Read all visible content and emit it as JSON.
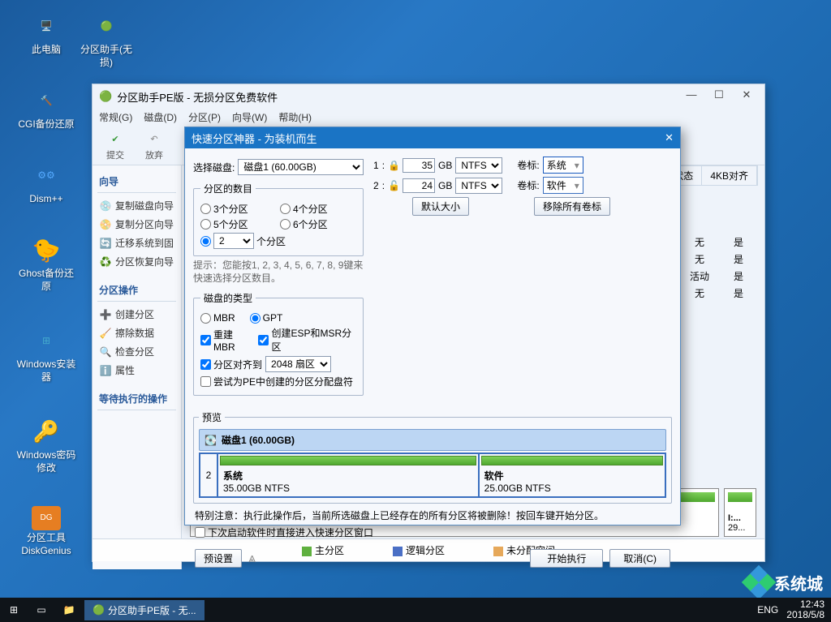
{
  "desktop": {
    "icons": [
      {
        "label": "此电脑",
        "icon": "🖥️"
      },
      {
        "label": "分区助手(无损)",
        "icon": "🔴"
      },
      {
        "label": "CGI备份还原",
        "icon": "🔨"
      },
      {
        "label": "Dism++",
        "icon": "⚙️"
      },
      {
        "label": "Ghost备份还原",
        "icon": "👻"
      },
      {
        "label": "Windows安装器",
        "icon": "🪟"
      },
      {
        "label": "Windows密码修改",
        "icon": "🔑"
      },
      {
        "label": "分区工具DiskGenius",
        "icon": "📀"
      }
    ]
  },
  "taskbar": {
    "app": "分区助手PE版 - 无...",
    "lang": "ENG",
    "time": "12:43",
    "date": "2018/5/8"
  },
  "watermark": "系统城",
  "main": {
    "title": "分区助手PE版 - 无损分区免费软件",
    "menu": [
      "常规(G)",
      "磁盘(D)",
      "分区(P)",
      "向导(W)",
      "帮助(H)"
    ],
    "tools": [
      {
        "label": "提交",
        "icon": "✔"
      },
      {
        "label": "放弃",
        "icon": "↩"
      }
    ],
    "sidebar": {
      "sec1": {
        "title": "向导",
        "items": [
          "复制磁盘向导",
          "复制分区向导",
          "迁移系统到固",
          "分区恢复向导"
        ]
      },
      "sec2": {
        "title": "分区操作",
        "items": [
          "创建分区",
          "擦除数据",
          "检查分区",
          "属性"
        ]
      },
      "sec3": {
        "title": "等待执行的操作"
      }
    },
    "grid": {
      "cols": [
        "状态",
        "4KB对齐"
      ],
      "rows": [
        [
          "无",
          "是"
        ],
        [
          "无",
          "是"
        ],
        [
          "活动",
          "是"
        ],
        [
          "无",
          "是"
        ]
      ]
    },
    "disks": [
      {
        "label": "I:...",
        "size": "29..."
      }
    ],
    "legend": {
      "primary": "主分区",
      "logical": "逻辑分区",
      "unalloc": "未分配空间"
    }
  },
  "dlg": {
    "title": "快速分区神器 - 为装机而生",
    "select_disk": "选择磁盘:",
    "disk_opt": "磁盘1 (60.00GB)",
    "count_label": "分区的数目",
    "counts": [
      "3个分区",
      "4个分区",
      "5个分区",
      "6个分区"
    ],
    "count_suffix": "个分区",
    "count_sel": "2",
    "hint": "提示：您能按1, 2, 3, 4, 5, 6, 7, 8, 9键来快速选择分区数目。",
    "type_label": "磁盘的类型",
    "mbr": "MBR",
    "gpt": "GPT",
    "rebuild": "重建MBR",
    "esp": "创建ESP和MSR分区",
    "align": "分区对齐到",
    "align_val": "2048 扇区",
    "try_pe": "尝试为PE中创建的分区分配盘符",
    "parts": [
      {
        "n": "1",
        "size": "35",
        "unit": "GB",
        "fs": "NTFS",
        "labelk": "卷标:",
        "labelv": "系统"
      },
      {
        "n": "2",
        "size": "24",
        "unit": "GB",
        "fs": "NTFS",
        "labelk": "卷标:",
        "labelv": "软件"
      }
    ],
    "default_size": "默认大小",
    "clear_labels": "移除所有卷标",
    "preview": "预览",
    "pv_disk": "磁盘1  (60.00GB)",
    "pv_num": "2",
    "pv_parts": [
      {
        "name": "系统",
        "size": "35.00GB NTFS"
      },
      {
        "name": "软件",
        "size": "25.00GB NTFS"
      }
    ],
    "warning": "特别注意：执行此操作后，当前所选磁盘上已经存在的所有分区将被删除！按回车键开始分区。",
    "next_open": "下次启动软件时直接进入快速分区窗口",
    "preset": "预设置",
    "exec": "开始执行",
    "cancel": "取消(C)"
  }
}
